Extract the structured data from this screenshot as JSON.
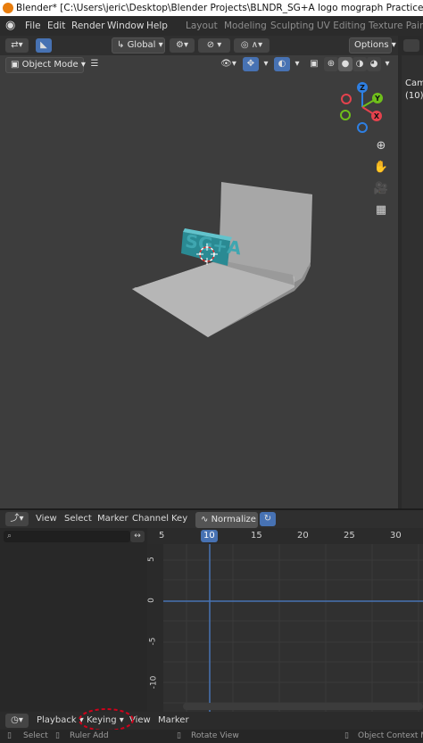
{
  "window": {
    "title": "Blender* [C:\\Users\\jeric\\Desktop\\Blender Projects\\BLNDR_SG+A logo mograph Practice\\Scenes\\SG+A mogra"
  },
  "menu": {
    "file": "File",
    "edit": "Edit",
    "render": "Render",
    "window": "Window",
    "help": "Help"
  },
  "workspaces": [
    "Layout",
    "Modeling",
    "Sculpting",
    "UV Editing",
    "Texture Paint"
  ],
  "viewport_header": {
    "transform_orientation": "Global",
    "options": "Options",
    "mode": "Object Mode"
  },
  "gizmo": {
    "z": "Z",
    "y": "Y",
    "x": "X"
  },
  "side_panel": {
    "camera_label": "Cam",
    "frame_label": "(10)"
  },
  "logo_text": "SG+A",
  "graph_editor": {
    "menus": {
      "view": "View",
      "select": "Select",
      "marker": "Marker",
      "channel": "Channel",
      "key": "Key"
    },
    "normalize": "Normalize",
    "frame_ticks": [
      "5",
      "10",
      "15",
      "20",
      "25",
      "30"
    ],
    "current_frame": "10",
    "value_ticks": [
      "5",
      "0",
      "-5",
      "-10"
    ]
  },
  "timeline": {
    "playback": "Playback",
    "keying": "Keying",
    "view": "View",
    "marker": "Marker"
  },
  "status_bar": {
    "select": "Select",
    "ruler_add": "Ruler Add",
    "rotate_view": "Rotate View",
    "context_menu": "Object Context Me"
  },
  "colors": {
    "background": "#3d3d3d",
    "accent_blue": "#4772b3",
    "highlight_circle": "#d0021b",
    "gizmo_x": "#e4424d",
    "gizmo_y": "#6fbf1b",
    "gizmo_z": "#2e7fe2"
  }
}
